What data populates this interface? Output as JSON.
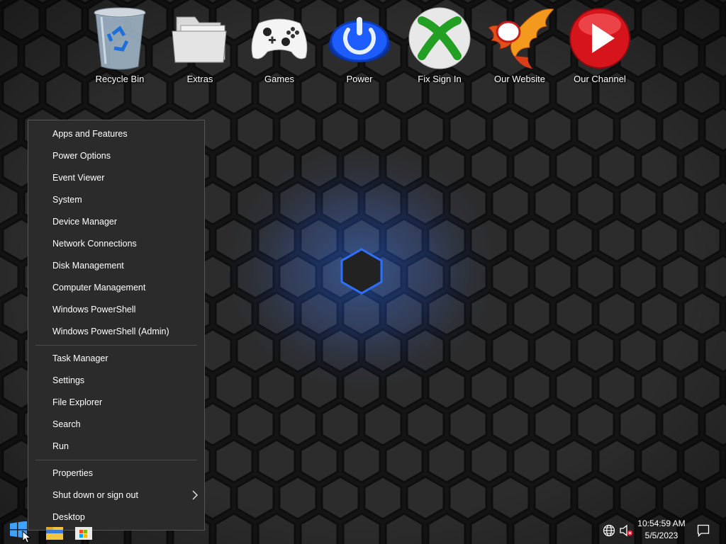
{
  "desktop": {
    "icons": [
      {
        "label": "Recycle Bin",
        "icon": "recycle-bin-icon"
      },
      {
        "label": "Extras",
        "icon": "folder-icon"
      },
      {
        "label": "Games",
        "icon": "gamepad-icon"
      },
      {
        "label": "Power",
        "icon": "power-icon"
      },
      {
        "label": "Fix Sign In",
        "icon": "xbox-icon"
      },
      {
        "label": "Our Website",
        "icon": "phoenix-icon"
      },
      {
        "label": "Our Channel",
        "icon": "play-icon"
      }
    ]
  },
  "menu": {
    "group1": [
      "Apps and Features",
      "Power Options",
      "Event Viewer",
      "System",
      "Device Manager",
      "Network Connections",
      "Disk Management",
      "Computer Management",
      "Windows PowerShell",
      "Windows PowerShell (Admin)"
    ],
    "group2": [
      "Task Manager",
      "Settings",
      "File Explorer",
      "Search",
      "Run"
    ],
    "group3": [
      "Properties",
      "Shut down or sign out",
      "Desktop"
    ]
  },
  "taskbar": {
    "time": "10:54:59 AM",
    "date": "5/5/2023"
  },
  "colors": {
    "accent": "#1e6cff",
    "menu_bg": "#2b2b2b"
  }
}
